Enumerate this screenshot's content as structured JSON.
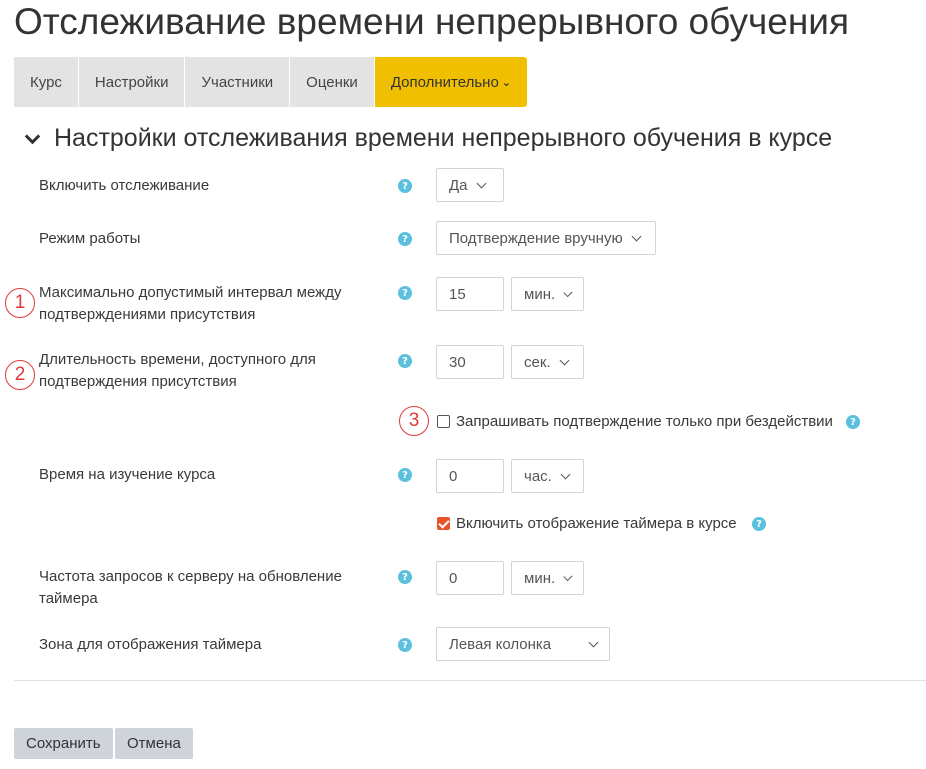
{
  "page": {
    "title": "Отслеживание времени непрерывного обучения"
  },
  "nav": {
    "tabs": [
      "Курс",
      "Настройки",
      "Участники",
      "Оценки"
    ],
    "more": {
      "label": "Дополнительно",
      "caret": "⌄"
    }
  },
  "section": {
    "title": "Настройки отслеживания времени непрерывного обучения в курсе"
  },
  "help_glyph": "?",
  "fields": {
    "enable": {
      "label": "Включить отслеживание",
      "value": "Да"
    },
    "mode": {
      "label": "Режим работы",
      "value": "Подтверждение вручную"
    },
    "max_interval": {
      "label": "Максимально допустимый интервал между подтверждениями присутствия",
      "value": "15",
      "unit": "мин.",
      "marker": "1"
    },
    "confirm_time": {
      "label": "Длительность времени, доступного для подтверждения присутствия",
      "value": "30",
      "unit": "сек.",
      "marker": "2"
    },
    "idle_only": {
      "label": "Запрашивать подтверждение только при бездействии",
      "checked": false,
      "marker": "3"
    },
    "study_time": {
      "label": "Время на изучение курса",
      "value": "0",
      "unit": "час."
    },
    "show_timer": {
      "label": "Включить отображение таймера в курсе",
      "checked": true
    },
    "refresh_rate": {
      "label": "Частота запросов к серверу на обновление таймера",
      "value": "0",
      "unit": "мин."
    },
    "timer_zone": {
      "label": "Зона для отображения таймера",
      "value": "Левая колонка"
    }
  },
  "buttons": {
    "save": "Сохранить",
    "cancel": "Отмена"
  },
  "colors": {
    "accent": "#f0bf00",
    "help": "#5bc0de",
    "checkbox": "#e8542a",
    "marker": "#e03a3a"
  }
}
